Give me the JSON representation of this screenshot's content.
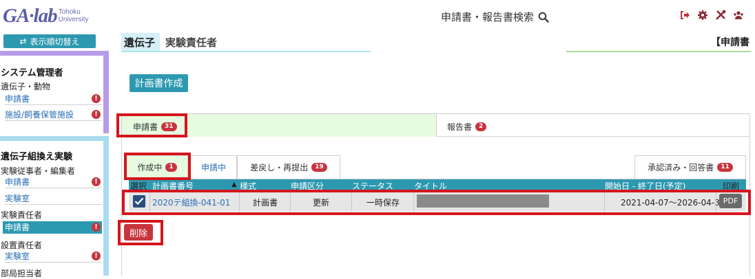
{
  "header": {
    "logo_main": "GA·lab",
    "logo_sub_1": "Tohoku",
    "logo_sub_2": "University",
    "search_title": "申請書・報告書検索",
    "icons": [
      "search-icon",
      "sign-out-icon",
      "gear-icon",
      "tools-icon",
      "users-icon"
    ]
  },
  "sidebar": {
    "sort_button": "表示順切替え",
    "panel1": {
      "title": "システム管理者",
      "group": "遺伝子・動物",
      "items": [
        {
          "label": "申請書",
          "badge": "!"
        },
        {
          "label": "施設/飼養保管施設",
          "badge": "!"
        }
      ]
    },
    "panel2": {
      "title": "遺伝子組換え実験",
      "group1": "実験従事者・編集者",
      "group1_items": [
        {
          "label": "申請書",
          "badge": "!"
        },
        {
          "label": "実験室",
          "badge": ""
        }
      ],
      "group2": "実験責任者",
      "group2_items": [
        {
          "label": "申請書",
          "badge": "!"
        }
      ],
      "group3": "設置責任者",
      "group3_items": [
        {
          "label": "実験室",
          "badge": "!"
        }
      ],
      "group4": "部局担当者"
    }
  },
  "breadcrumb": {
    "section": "遺伝子",
    "role": "実験責任者",
    "right_title": "【申請書"
  },
  "create_button": "計画書作成",
  "tabs": {
    "applications": {
      "label": "申請書",
      "count": "31"
    },
    "reports": {
      "label": "報告書",
      "count": "2"
    }
  },
  "subtabs": {
    "drafting": {
      "label": "作成中",
      "count": "1"
    },
    "applying": {
      "label": "申請中"
    },
    "returned": {
      "label": "差戻し・再提出",
      "count": "19"
    },
    "approved": {
      "label": "承認済み・回答書",
      "count": "11"
    }
  },
  "table": {
    "headers": [
      "選択",
      "計画書番号",
      "▲",
      "様式",
      "申請区分",
      "ステータス",
      "タイトル",
      "開始日 - 終了日(予定)",
      "印刷"
    ],
    "row": {
      "checked": true,
      "number": "2020テ組換-041-01",
      "form": "計画書",
      "category": "更新",
      "status": "一時保存",
      "title": "",
      "period": "2021-04-07～2026-04-30",
      "print": "PDF"
    }
  },
  "delete_button": "削除",
  "colors": {
    "accent": "#2d99b0",
    "danger": "#c8343e",
    "highlight": "#d4161c",
    "active_tab": "#e6fbe0"
  }
}
